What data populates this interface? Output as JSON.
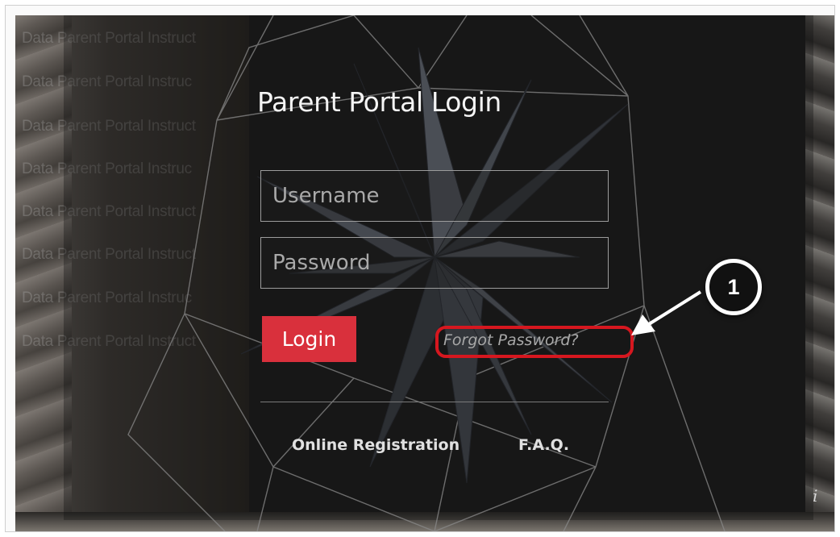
{
  "login": {
    "title": "Parent Portal Login",
    "username_placeholder": "Username",
    "password_placeholder": "Password",
    "login_label": "Login",
    "forgot_label": "Forgot Password?"
  },
  "footer": {
    "registration_label": "Online Registration",
    "faq_label": "F.A.Q."
  },
  "info_icon": "i",
  "background": {
    "ghost_lines": [
      "Data Parent Portal Instruct",
      "Data Parent Portal Instruc",
      "Data Parent Portal Instruct",
      "Data Parent Portal Instruc",
      "Data Parent Portal Instruct",
      "Data Parent Portal Instruct",
      "Data Parent Portal Instruc",
      "Data Parent Portal Instruct"
    ],
    "artwork": "crystal-star-sculpture"
  },
  "annotation": {
    "step_number": "1",
    "color": "#d6171f"
  },
  "colors": {
    "login_button": "#d9303c",
    "callout_ring": "#d6171f"
  }
}
